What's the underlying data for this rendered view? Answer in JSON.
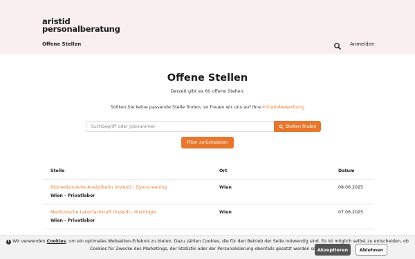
{
  "header": {
    "logo_line1": "aristid",
    "logo_line2": "personalberatung",
    "nav_jobs": "Offene Stellen",
    "login": "Anmelden"
  },
  "main": {
    "title": "Offene Stellen",
    "subtitle": "Derzeit gibt es 60 offene Stellen.",
    "hint_prefix": "Sollten Sie keine passende Stelle finden, so freuen wir uns auf Ihre ",
    "hint_link": "Initiativbewerbung",
    "search_placeholder": "Suchbegriff oder Jobnummer",
    "search_button": "Stellen finden",
    "reset_button": "Filter zurücksetzen"
  },
  "table": {
    "headers": {
      "stelle": "Stelle",
      "ort": "Ort",
      "datum": "Datum"
    },
    "rows": [
      {
        "title": "Biomedizinische Analytikerin (m/w/d) - Zytoscreening",
        "sub": "Wien - Privatlabor",
        "ort": "Wien",
        "datum": "08.06.2025"
      },
      {
        "title": "Medizinische Laborfachkraft (m/w/d) - Histologie",
        "sub": "Wien - Privatlabor",
        "ort": "Wien",
        "datum": "07.06.2025"
      }
    ]
  },
  "cookie": {
    "text_1": "Wir verwenden ",
    "link": "Cookies",
    "text_2": ", um ein optimales Webseiten-Erlebnis zu bieten. Dazu zählen Cookies, die für den Betrieb der Seite notwendig sind. Es ist möglich selbst zu entscheiden, ob Cookies für Zwecke des Marketings, der Statistik oder der Personalisierung ebenfalls gesetzt werden sollen.",
    "accept": "Akzeptieren",
    "decline": "Ablehnen"
  },
  "colors": {
    "accent": "#e8772e",
    "header_bg": "#f8efee"
  },
  "icons": {
    "search": "search-icon",
    "info": "info-icon"
  }
}
